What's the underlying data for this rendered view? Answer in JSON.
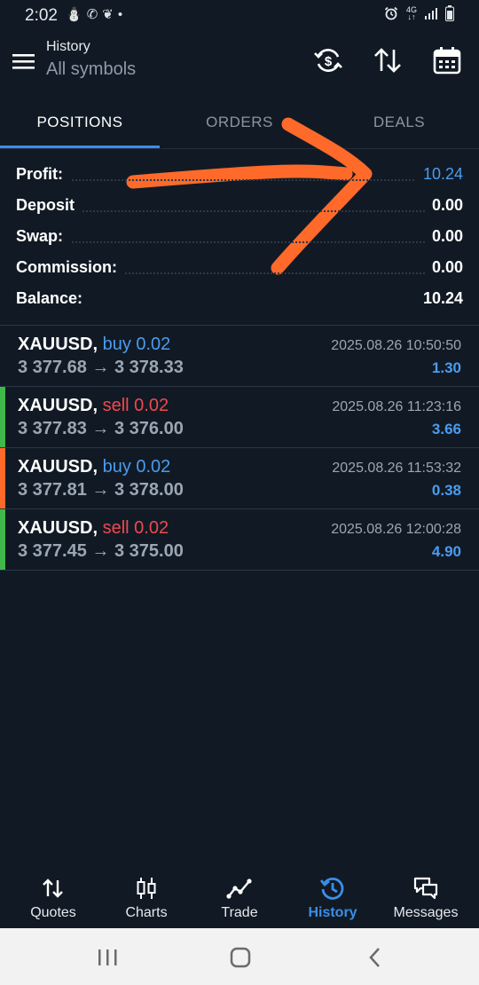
{
  "status_bar": {
    "time": "2:02",
    "net_top": "4G",
    "net_bottom": "↓↑"
  },
  "header": {
    "title": "History",
    "subtitle": "All symbols"
  },
  "tabs": [
    {
      "label": "POSITIONS",
      "active": true
    },
    {
      "label": "ORDERS",
      "active": false
    },
    {
      "label": "DEALS",
      "active": false
    }
  ],
  "summary": {
    "profit_label": "Profit:",
    "profit_value": "10.24",
    "deposit_label": "Deposit",
    "deposit_value": "0.00",
    "swap_label": "Swap:",
    "swap_value": "0.00",
    "commission_label": "Commission:",
    "commission_value": "0.00",
    "balance_label": "Balance:",
    "balance_value": "10.24"
  },
  "deals": [
    {
      "symbol": "XAUUSD,",
      "direction": "buy 0.02",
      "prices": "3 377.68 → 3 378.33",
      "time": "2025.08.26 10:50:50",
      "profit": "1.30",
      "marker": "none"
    },
    {
      "symbol": "XAUUSD,",
      "direction": "sell 0.02",
      "prices": "3 377.83 → 3 376.00",
      "time": "2025.08.26 11:23:16",
      "profit": "3.66",
      "marker": "green"
    },
    {
      "symbol": "XAUUSD,",
      "direction": "buy 0.02",
      "prices": "3 377.81 → 3 378.00",
      "time": "2025.08.26 11:53:32",
      "profit": "0.38",
      "marker": "orange"
    },
    {
      "symbol": "XAUUSD,",
      "direction": "sell 0.02",
      "prices": "3 377.45 → 3 375.00",
      "time": "2025.08.26 12:00:28",
      "profit": "4.90",
      "marker": "green"
    }
  ],
  "bottom_nav": [
    {
      "label": "Quotes",
      "icon": "quotes-icon",
      "active": false
    },
    {
      "label": "Charts",
      "icon": "charts-icon",
      "active": false
    },
    {
      "label": "Trade",
      "icon": "trade-icon",
      "active": false
    },
    {
      "label": "History",
      "icon": "history-icon",
      "active": true
    },
    {
      "label": "Messages",
      "icon": "messages-icon",
      "active": false
    }
  ],
  "colors": {
    "background": "#111a24",
    "accent": "#3b8ee8",
    "sell": "#f0484e",
    "buy": "#4a9cf0",
    "annotation": "#ff6a2a",
    "marker_green": "#3fb94a",
    "marker_orange": "#ff6a2a"
  }
}
